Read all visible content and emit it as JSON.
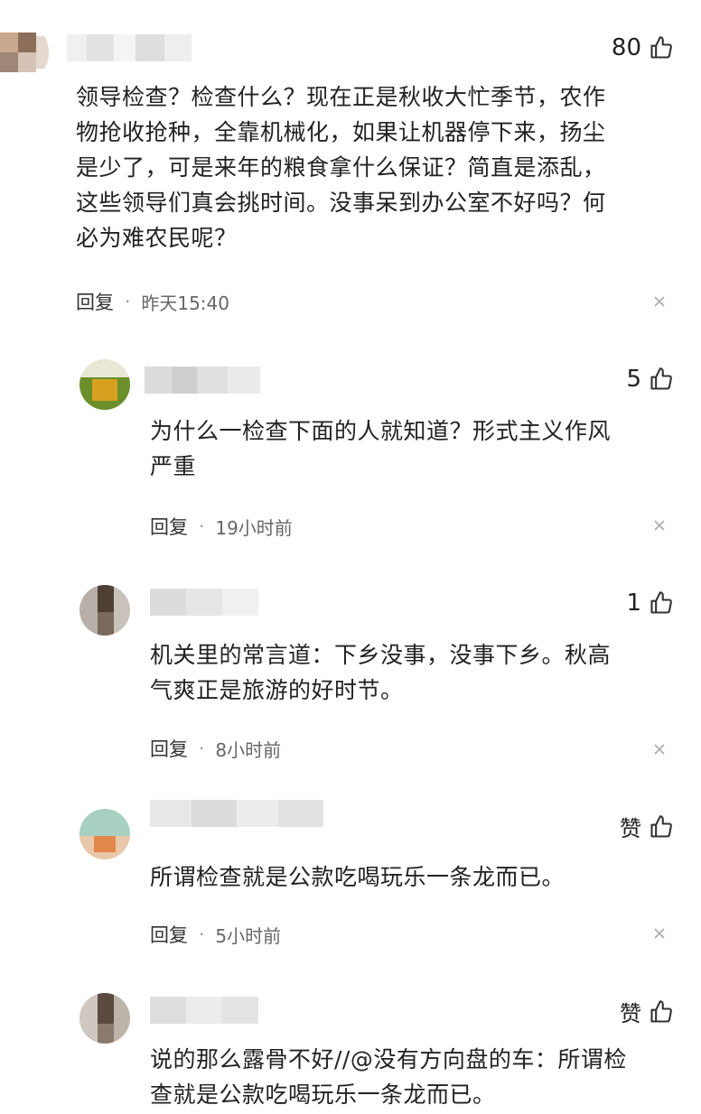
{
  "comments": [
    {
      "likes": "80",
      "text": [
        "领导检查？检查什么？现在正是秋收大忙季节，农作",
        "物抢收抢种，全靠机械化，如果让机器停下来，扬尘",
        "是少了，可是来年的粮食拿什么保证？简直是添乱，",
        "这些领导们真会挑时间。没事呆到办公室不好吗？何",
        "必为难农民呢？"
      ],
      "reply": "回复",
      "dot": "·",
      "time": "昨天15:40"
    },
    {
      "likes": "5",
      "text": [
        "为什么一检查下面的人就知道？形式主义作风",
        "严重"
      ],
      "reply": "回复",
      "dot": "·",
      "time": "19小时前"
    },
    {
      "likes": "1",
      "text": [
        "机关里的常言道：下乡没事，没事下乡。秋高",
        "气爽正是旅游的好时节。"
      ],
      "reply": "回复",
      "dot": "·",
      "time": "8小时前"
    },
    {
      "likes": "赞",
      "text": [
        "所谓检查就是公款吃喝玩乐一条龙而已。"
      ],
      "reply": "回复",
      "dot": "·",
      "time": "5小时前"
    },
    {
      "likes": "赞",
      "text": [
        "说的那么露骨不好//@没有方向盘的车：所谓检",
        "查就是公款吃喝玩乐一条龙而已。"
      ]
    }
  ],
  "icons": {
    "like": "thumbs-up-icon",
    "close": "close-icon"
  },
  "colors": {
    "text": "#222222",
    "meta": "#666666",
    "icon": "#333333"
  }
}
